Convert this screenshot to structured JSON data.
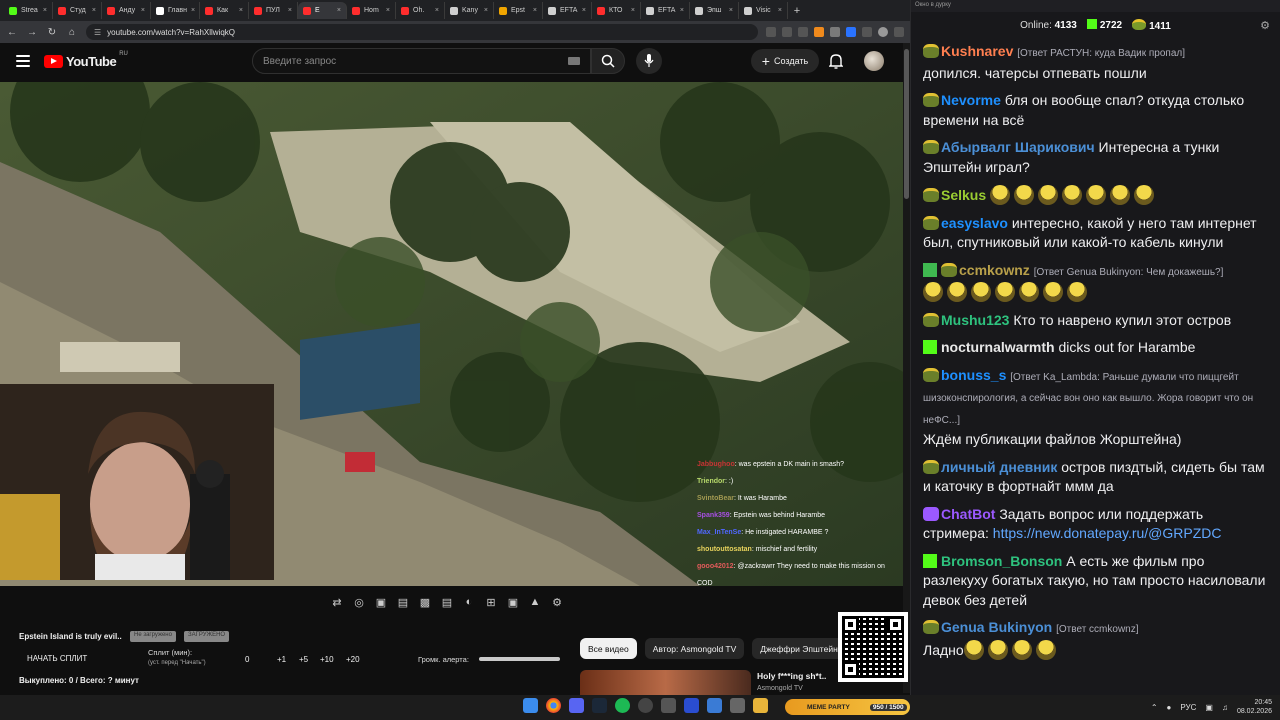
{
  "browser": {
    "tabs": [
      {
        "label": "Strea",
        "color": "#53fc18"
      },
      {
        "label": "Студ",
        "color": "#ff2d2d"
      },
      {
        "label": "Анду",
        "color": "#ff2d2d"
      },
      {
        "label": "Главн",
        "color": "#ffffff"
      },
      {
        "label": "Как",
        "color": "#ff2d2d"
      },
      {
        "label": "ПУЛ",
        "color": "#ff2d2d"
      },
      {
        "label": "Е",
        "color": "#ff2d2d"
      },
      {
        "label": "Hom",
        "color": "#ff2d2d"
      },
      {
        "label": "Oh.",
        "color": "#ff2d2d"
      },
      {
        "label": "Kany",
        "color": "#cfcfcf"
      },
      {
        "label": "Epst",
        "color": "#f0a500"
      },
      {
        "label": "EFTA",
        "color": "#cfcfcf"
      },
      {
        "label": "КТО",
        "color": "#ff2d2d"
      },
      {
        "label": "EFTA",
        "color": "#cfcfcf"
      },
      {
        "label": "Эпш",
        "color": "#cfcfcf"
      },
      {
        "label": "Visic",
        "color": "#cfcfcf"
      }
    ],
    "active_tab": 6,
    "url": "youtube.com/watch?v=RahXllwiqkQ"
  },
  "youtube": {
    "logo": "YouTube",
    "region": "RU",
    "search_placeholder": "Введите запрос",
    "create_label": "Создать"
  },
  "overlay_chat": [
    {
      "user": "Jabbughoo",
      "text": "was epstein a DK main in smash?",
      "color": "#c73434"
    },
    {
      "user": "Triendor",
      "text": ":)",
      "color": "#b7d96b"
    },
    {
      "user": "SvintoBear",
      "text": "It was Harambe",
      "color": "#a39a52"
    },
    {
      "user": "Spank359",
      "text": "Epstein was behind Harambe",
      "color": "#a74fe3"
    },
    {
      "user": "Max_InTenSe",
      "text": "He instigated HARAMBE ?",
      "color": "#5067ff"
    },
    {
      "user": "shoutouttosatan",
      "text": "mischief and fertility",
      "color": "#e7d25c"
    },
    {
      "user": "gooo42012",
      "text": "@zackrawrr They need to make this mission on COD",
      "color": "#e35b5b"
    }
  ],
  "controls": {
    "video_title": "Epstein Island is truly evil..",
    "chip1": "Не загружено",
    "chip2": "ЗАГРУЖЕНО",
    "split_button": "НАЧАТЬ СПЛИТ",
    "split_label": "Сплит (мин):",
    "split_hint": "(уст. перед \"Начать\")",
    "split_value": "0",
    "increments": [
      "+1",
      "+5",
      "+10",
      "+20"
    ],
    "volume_label": "Громк. алерта:",
    "volume_level": 1.0,
    "bought": "Выкуплено: 0 / Всего: ? минут"
  },
  "filters": [
    "Все видео",
    "Автор: Asmongold TV",
    "Джеффри Эпштейн"
  ],
  "recommended": {
    "title": "Holy f***ing sh*t..",
    "channel": "Asmongold TV"
  },
  "chat": {
    "header": "Окно в дурку",
    "online_label": "Online:",
    "online": "4133",
    "kick_count": "2722",
    "pepe_count": "1411",
    "messages": [
      {
        "user": "Kushnarev",
        "color": "#ff7f50",
        "reply": "[Ответ РАСТУН: куда Вадик пропал]",
        "text": "допился. чатерсы отпевать пошли",
        "badge": "pepe"
      },
      {
        "user": "Nevorme",
        "color": "#1e90ff",
        "reply": "",
        "text": "бля он вообще спал? откуда столько времени на всё",
        "badge": "pepe"
      },
      {
        "user": "Абырвалг Шарикович",
        "color": "#4b8fd6",
        "reply": "",
        "text": "Интересна а тунки Эпштейн играл?",
        "badge": "pepe"
      },
      {
        "user": "Selkus",
        "color": "#9acd32",
        "reply": "",
        "text": "",
        "badge": "pepe",
        "emotes": 7
      },
      {
        "user": "easyslavo",
        "color": "#1e90ff",
        "reply": "",
        "text": "интересно, какой у него там интернет был, спутниковый или какой-то кабель кинули",
        "badge": "pepe"
      },
      {
        "user": "ccmkownz",
        "color": "#b8a04a",
        "reply": "[Ответ Genua Bukinyon: Чем докажешь?]",
        "text": "",
        "badge": "sword",
        "emotes": 7
      },
      {
        "user": "Mushu123",
        "color": "#2ec27e",
        "reply": "",
        "text": "Кто то наврено купил этот остров",
        "badge": "pepe"
      },
      {
        "user": "nocturnalwarmth",
        "color": "#e8e8e8",
        "reply": "",
        "text": "dicks out for Harambe",
        "badge": "kick"
      },
      {
        "user": "bonuss_s",
        "color": "#1e90ff",
        "reply": "[Ответ Ka_Lambda: Раньше думали что пиццгейт шизоконспирология, а сейчас вон оно как вышло. Жора говорит что он неФС...]",
        "text": "Ждём публикации файлов Жорштейна)",
        "badge": "pepe"
      },
      {
        "user": "личный дневник",
        "color": "#4b8fd6",
        "reply": "",
        "text": "остров пиздтый, сидеть бы там и каточку в фортнайт ммм да",
        "badge": "pepe"
      },
      {
        "user": "ChatBot",
        "color": "#9b59ff",
        "reply": "",
        "text": "Задать вопрос или поддержать стримера: ",
        "link": "https://new.donatepay.ru/@GRPZDC",
        "badge": "bot"
      },
      {
        "user": "Bromson_Bonson",
        "color": "#2ec27e",
        "reply": "",
        "text": "А есть же фильм про разлекуху богатых такую, но там просто насиловали девок без детей",
        "badge": "kick"
      },
      {
        "user": "Genua Bukinyon",
        "color": "#4b8fd6",
        "reply": "[Ответ ccmkownz]",
        "text": "Ладно",
        "badge": "pepe",
        "emotes": 4
      }
    ]
  },
  "taskbar": {
    "meme_label": "MEME PARTY",
    "meme_count": "950 / 1500",
    "lang": "РУС",
    "time": "20:45",
    "date": "08.02.2026"
  }
}
